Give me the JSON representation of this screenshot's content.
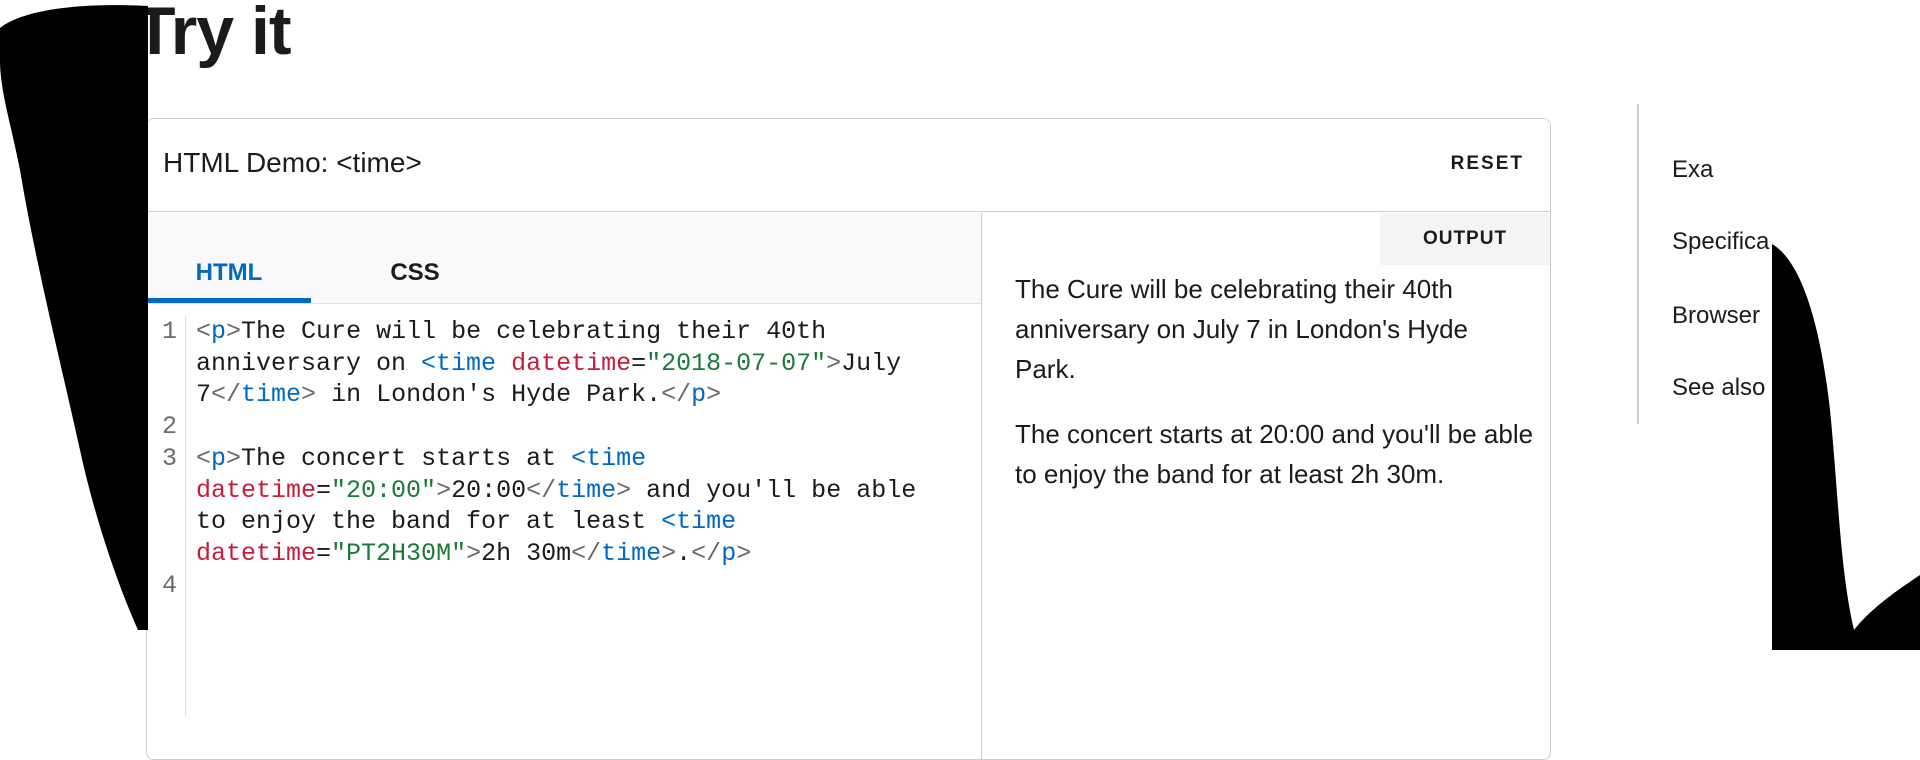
{
  "page": {
    "heading": "Try it"
  },
  "demo": {
    "title": "HTML Demo: <time>",
    "reset_label": "RESET",
    "tabs": [
      {
        "label": "HTML",
        "active": true
      },
      {
        "label": "CSS",
        "active": false
      }
    ],
    "output_label": "OUTPUT",
    "line_numbers": [
      "1",
      "2",
      "3",
      "4"
    ],
    "output_paragraphs": [
      "The Cure will be celebrating their 40th anniversary on July 7 in London's Hyde Park.",
      "The concert starts at 20:00 and you'll be able to enjoy the band for at least 2h 30m."
    ]
  },
  "code_tokens": {
    "p_open": "<p>",
    "p_close": "</p>",
    "time_open_tag": "<time",
    "time_close": "</time>",
    "attr_datetime": "datetime",
    "eq": "=",
    "gt": ">",
    "lt": "<",
    "l1_text_a": "The Cure will be celebrating their 40th",
    "l1_text_b": "anniversary on ",
    "l1_val": "\"2018-07-07\"",
    "l1_text_c": "July",
    "l1_text_d": "7",
    "l1_text_e": " in London's Hyde Park.",
    "l3_text_a": "The concert starts at ",
    "l3_val_a": "\"20:00\"",
    "l3_text_b": "20:00",
    "l3_text_c": " and you'll be able",
    "l3_text_d": "to enjoy the band for at least ",
    "l3_val_b": "\"PT2H30M\"",
    "l3_text_e": "2h 30m",
    "l3_text_f": "."
  },
  "toc": {
    "items": [
      "Exa",
      "Specifica",
      "Browser",
      "See also"
    ]
  },
  "colors": {
    "accent": "#0069c2",
    "tag": "#0069c2",
    "attribute": "#c41e3a",
    "string": "#1b7a3a",
    "border": "#cdcdcd"
  }
}
